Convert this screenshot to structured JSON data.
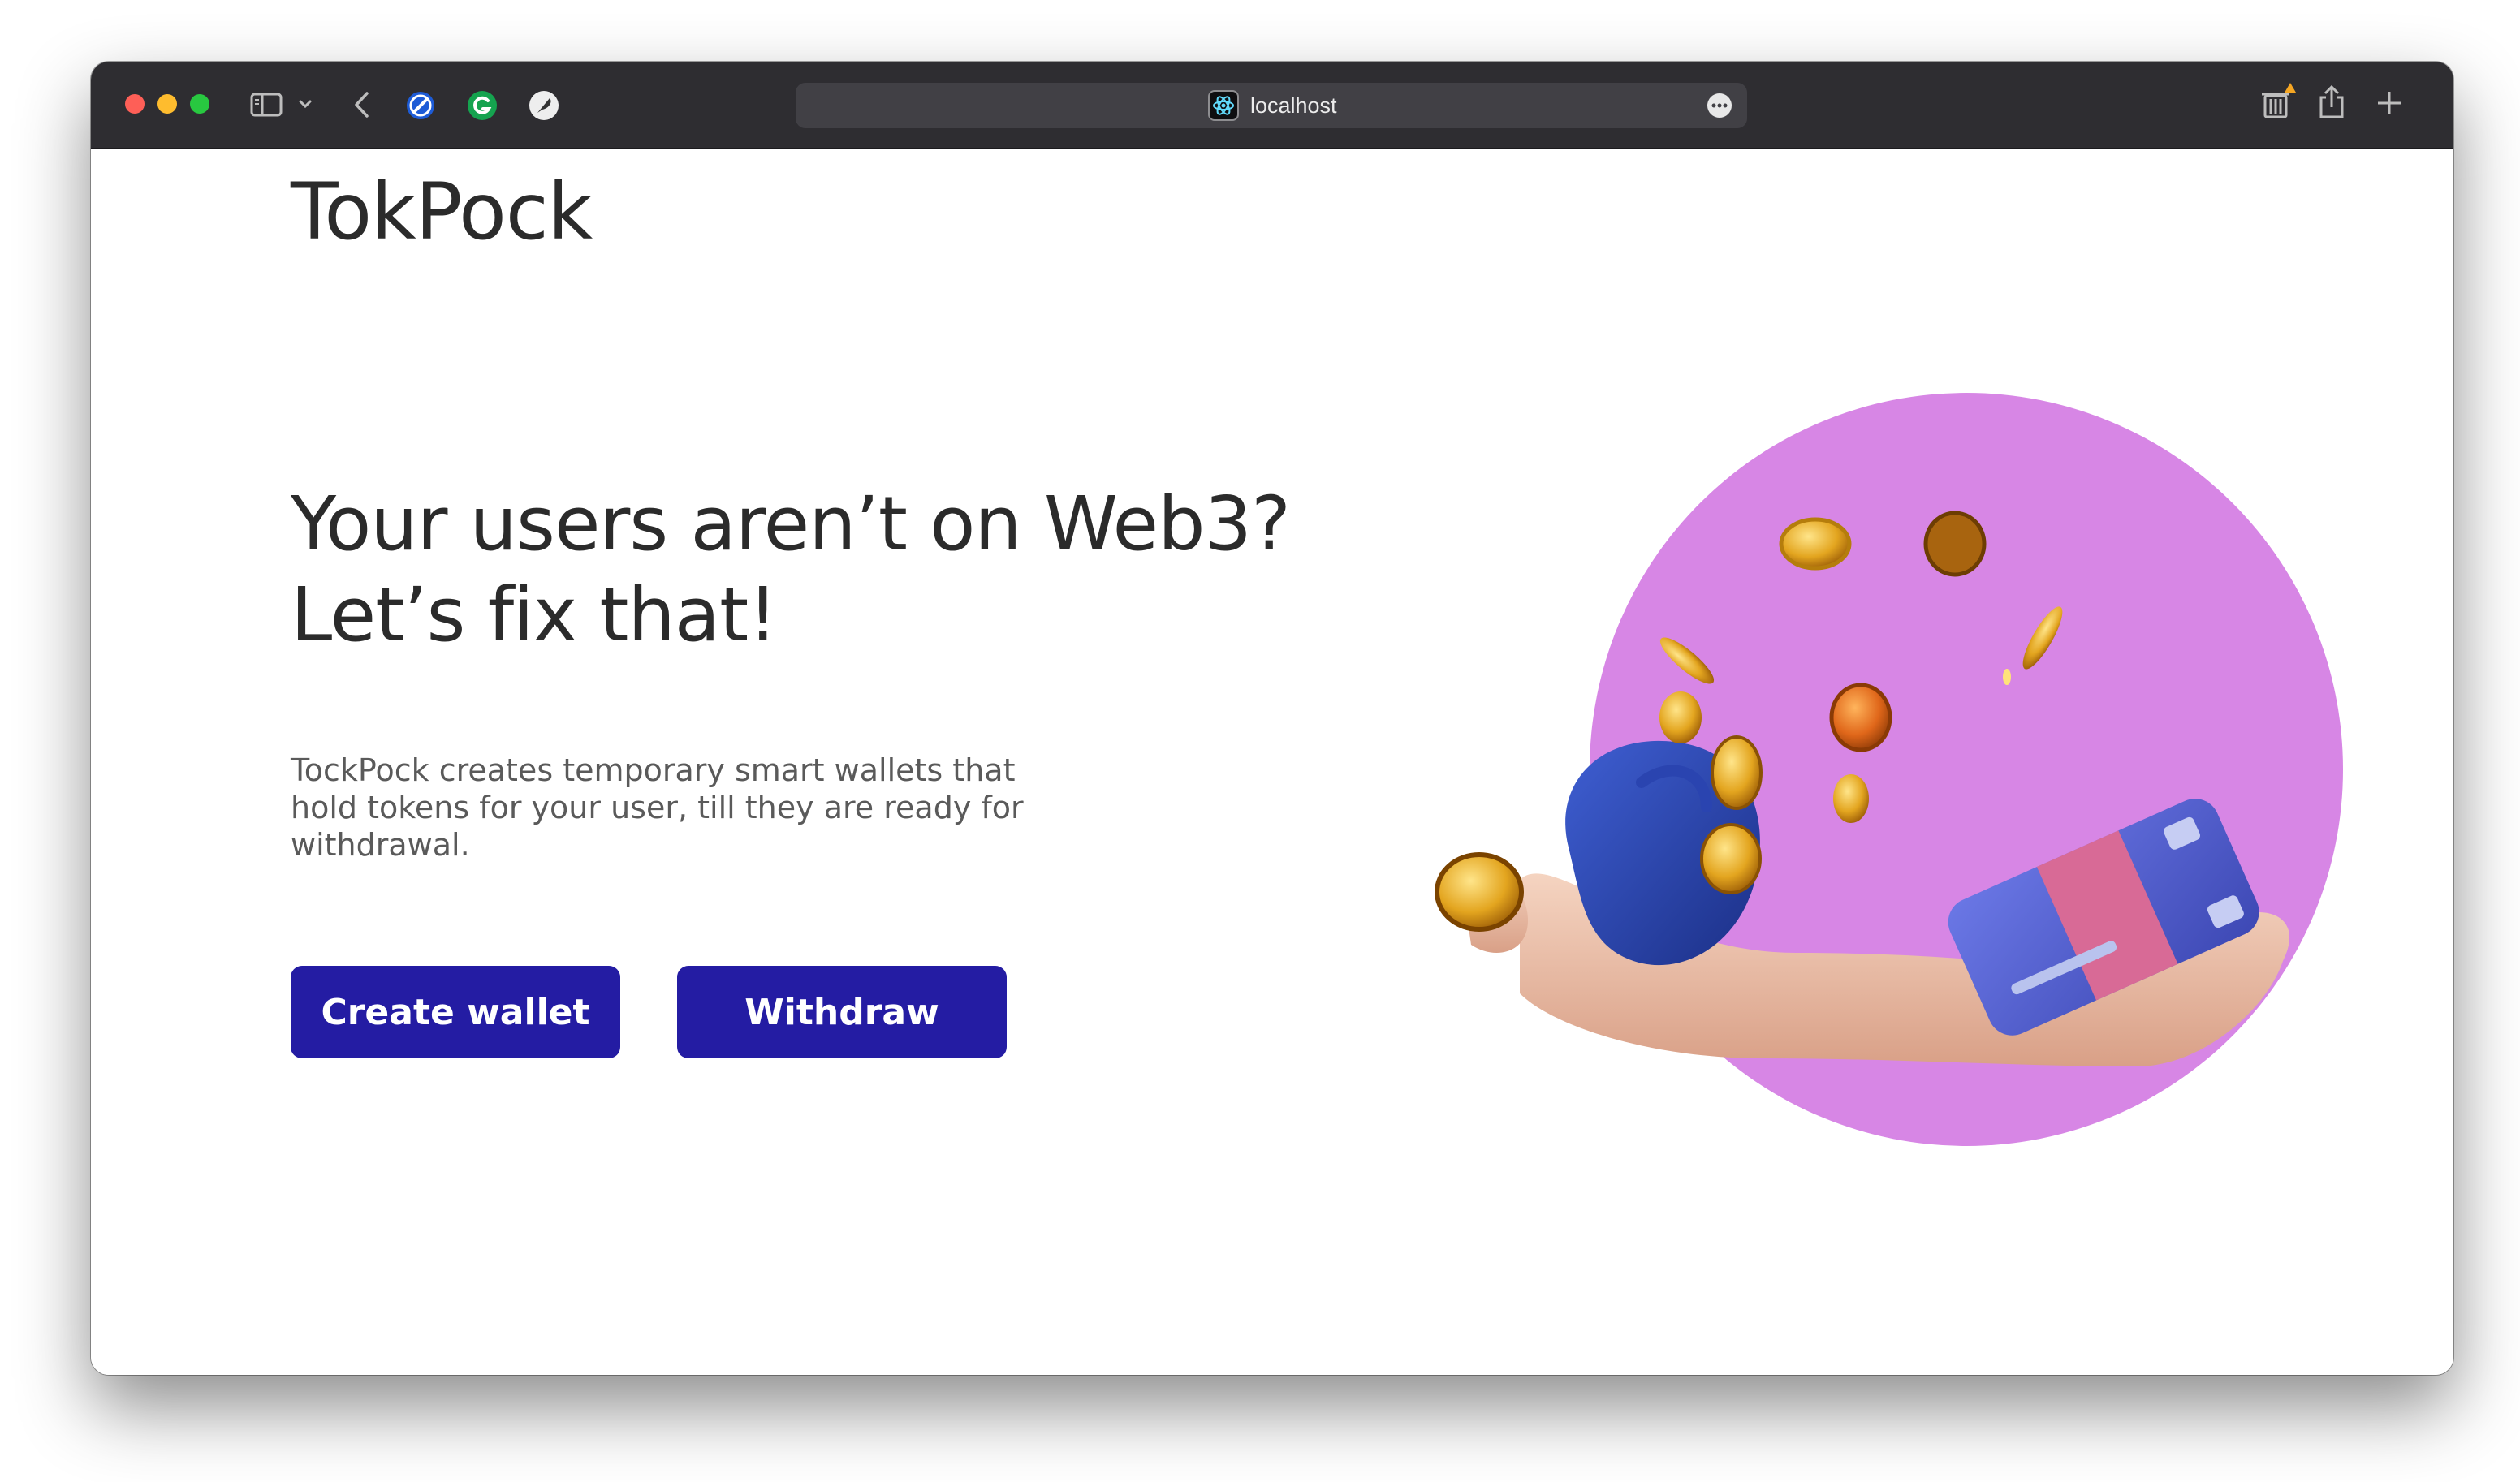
{
  "browser": {
    "address": "localhost",
    "icons": [
      "sidebar-icon",
      "chevron-down-icon",
      "back-icon",
      "compass-extension-icon",
      "grammarly-icon",
      "feather-extension-icon",
      "more-icon",
      "trash-icon",
      "share-icon",
      "plus-icon"
    ]
  },
  "page": {
    "brand": "TokPock",
    "headline_line1": "Your users aren’t on Web3?",
    "headline_line2": "Let’s fix that!",
    "description": "TockPock creates temporary smart wallets that hold tokens for your user, till they are ready for withdrawal.",
    "buttons": {
      "create_wallet": "Create wallet",
      "withdraw": "Withdraw"
    }
  },
  "colors": {
    "toolbar": "#2e2d31",
    "button": "#241ca3",
    "circle": "#d786e5",
    "text": "#2b2b2b"
  }
}
